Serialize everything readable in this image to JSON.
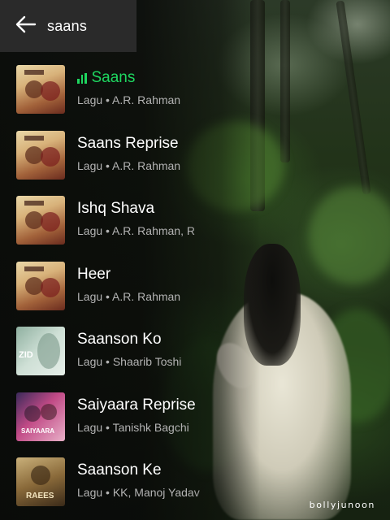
{
  "search": {
    "query": "saans"
  },
  "results": [
    {
      "title": "Saans",
      "subtitle": "Lagu • A.R. Rahman",
      "now_playing": true,
      "art": "jab-tak-hai-jaan-cover"
    },
    {
      "title": "Saans Reprise",
      "subtitle": "Lagu • A.R. Rahman",
      "now_playing": false,
      "art": "jab-tak-hai-jaan-cover"
    },
    {
      "title": "Ishq Shava",
      "subtitle": "Lagu • A.R. Rahman, R",
      "now_playing": false,
      "art": "jab-tak-hai-jaan-cover"
    },
    {
      "title": "Heer",
      "subtitle": "Lagu • A.R. Rahman",
      "now_playing": false,
      "art": "jab-tak-hai-jaan-cover"
    },
    {
      "title": "Saanson Ko",
      "subtitle": "Lagu • Shaarib Toshi",
      "now_playing": false,
      "art": "zid-cover"
    },
    {
      "title": "Saiyaara Reprise",
      "subtitle": "Lagu • Tanishk Bagchi",
      "now_playing": false,
      "art": "saiyaara-cover"
    },
    {
      "title": "Saanson Ke",
      "subtitle": "Lagu • KK, Manoj Yadav",
      "now_playing": false,
      "art": "raees-cover"
    }
  ],
  "thumb_labels": {
    "zid": "ZID",
    "saiyaara": "SAIYAARA",
    "raees": "RAEES"
  },
  "watermark": "bollyjunoon",
  "colors": {
    "accent": "#1ed760",
    "header_bg": "#2a2a2a",
    "subtitle": "#b3b3b3"
  }
}
